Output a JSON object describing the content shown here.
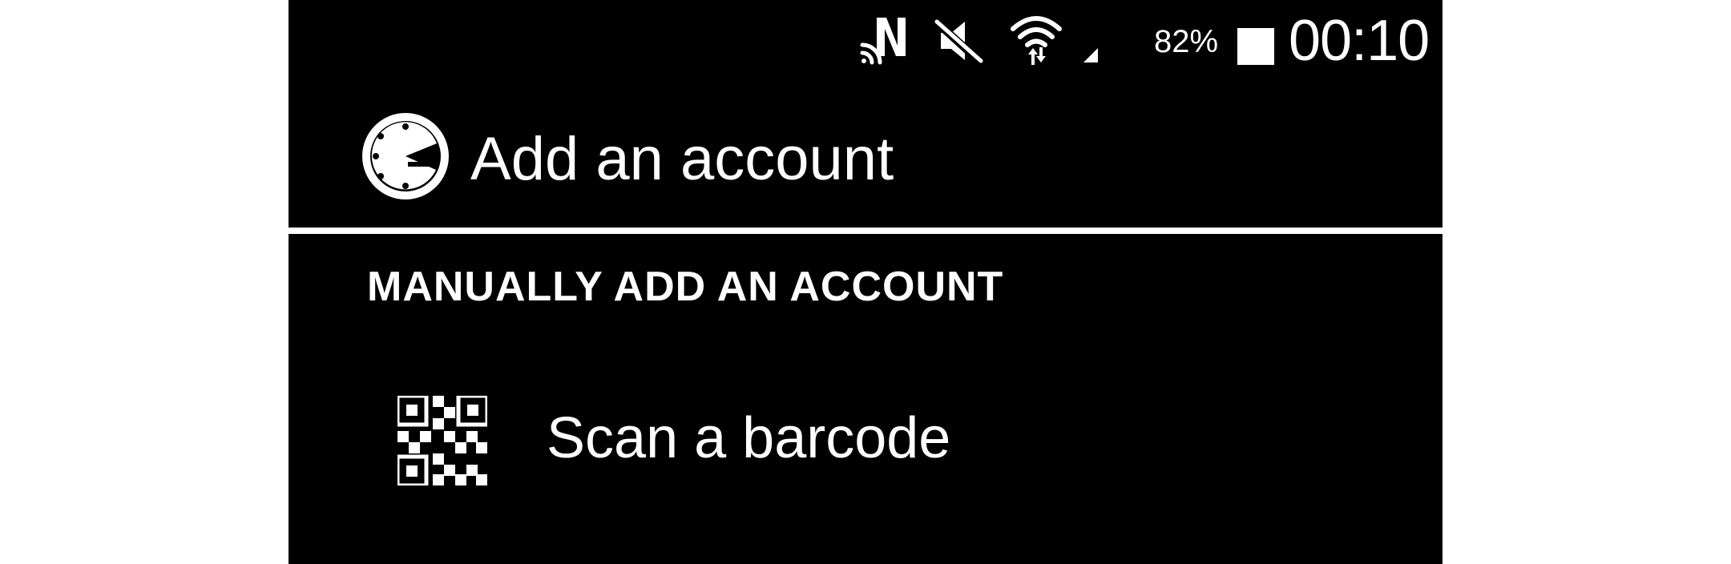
{
  "status_bar": {
    "battery_percent": "82%",
    "time": "00:10",
    "icons": [
      "nfc-icon",
      "mute-icon",
      "wifi-icon",
      "signal-icon",
      "battery-icon"
    ]
  },
  "header": {
    "logo_icon": "authenticator-logo-icon",
    "title": "Add an account"
  },
  "section": {
    "heading": "MANUALLY ADD AN ACCOUNT"
  },
  "actions": {
    "scan_barcode_icon": "qr-code-icon",
    "scan_barcode_label": "Scan a barcode"
  },
  "colors": {
    "background": "#000000",
    "foreground": "#ffffff",
    "outer_background": "#ffffff"
  }
}
